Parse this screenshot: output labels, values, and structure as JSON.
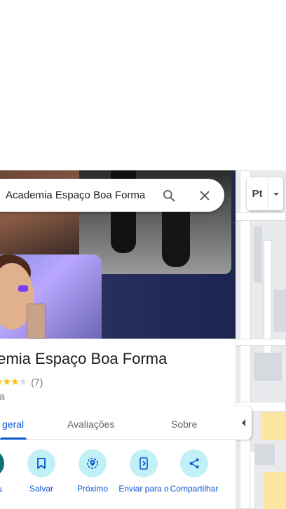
{
  "search": {
    "value": "Academia Espaço Boa Forma"
  },
  "place": {
    "title": "demia Espaço Boa Forma",
    "stars_visible": "★★★",
    "stars_empty": "★",
    "review_count": "(7)",
    "category": "nia",
    "rating_stars": 3
  },
  "tabs": [
    {
      "label": "geral",
      "active": true
    },
    {
      "label": "Avaliações",
      "active": false
    },
    {
      "label": "Sobre",
      "active": false
    }
  ],
  "actions": {
    "partial_label": "s",
    "items": [
      {
        "label": "Salvar",
        "icon": "bookmark-icon"
      },
      {
        "label": "Próximo",
        "icon": "nearby-icon"
      },
      {
        "label": "Enviar para o",
        "icon": "send-to-phone-icon"
      },
      {
        "label": "Compartilhar",
        "icon": "share-icon"
      }
    ]
  },
  "map": {
    "layers_label": "Pt"
  },
  "colors": {
    "accent": "#0b57d0",
    "action_bg": "#c2f0f7",
    "star": "#fbbc04"
  }
}
